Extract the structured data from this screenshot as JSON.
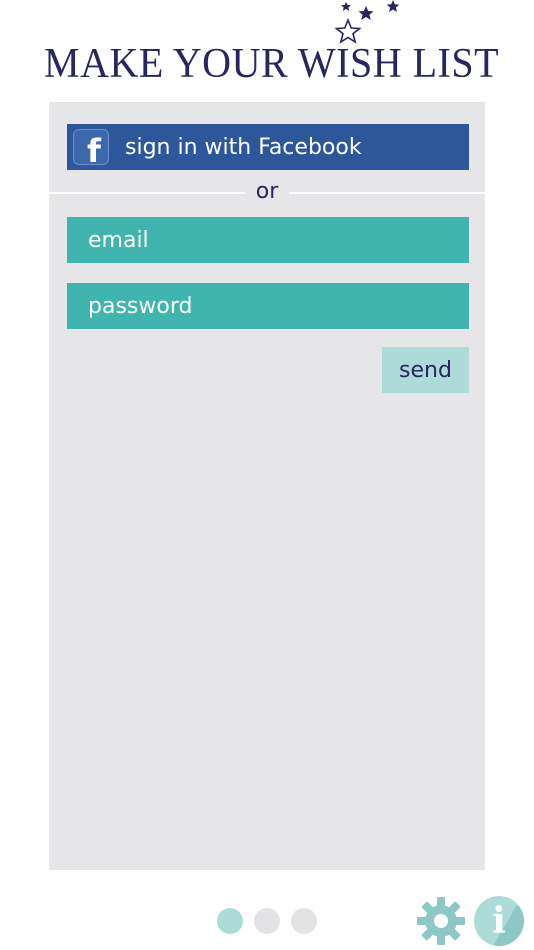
{
  "header": {
    "logo_text": "MAKE YOUR WISH LIST"
  },
  "login": {
    "facebook_label": "sign in with Facebook",
    "divider_text": "or",
    "email_placeholder": "email",
    "password_placeholder": "password",
    "send_label": "send"
  },
  "pager": {
    "total": 3,
    "active_index": 0
  },
  "footer": {
    "settings_icon": "gear-icon",
    "info_icon": "info-icon",
    "info_glyph": "i"
  },
  "colors": {
    "navy": "#27265f",
    "facebook": "#2d579a",
    "teal": "#40b5b0",
    "light_teal": "#acdbd8",
    "panel": "#e6e6e9"
  }
}
